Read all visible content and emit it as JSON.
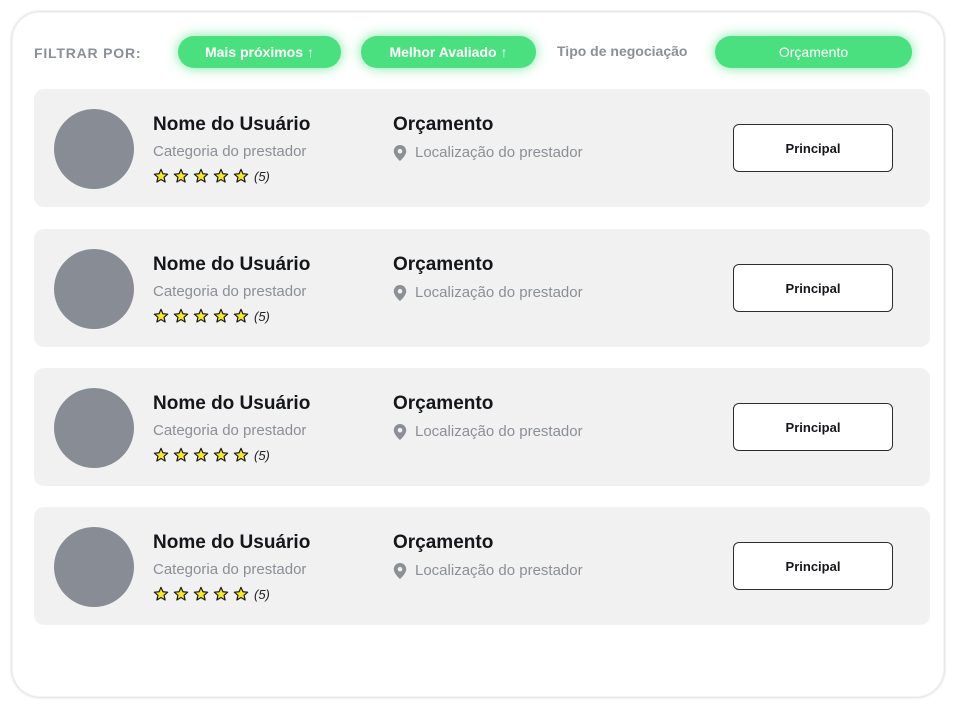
{
  "filters": {
    "label": "FILTRAR POR:",
    "nearest": {
      "label": "Mais próximos",
      "arrow": "↑"
    },
    "best_rated": {
      "label": "Melhor Avaliado",
      "arrow": "↑"
    },
    "negotiation_label": "Tipo de negociação",
    "negotiation_value": "Orçamento"
  },
  "colors": {
    "accent": "#4be07f",
    "card_bg": "#f1f1f1",
    "avatar": "#878c95",
    "star_fill": "#f5e733"
  },
  "cards": [
    {
      "name": "Nome do Usuário",
      "category": "Categoria do prestador",
      "stars": 5,
      "rating_count": "(5)",
      "negotiation": "Orçamento",
      "location": "Localização do prestador",
      "button": "Principal"
    },
    {
      "name": "Nome do Usuário",
      "category": "Categoria do prestador",
      "stars": 5,
      "rating_count": "(5)",
      "negotiation": "Orçamento",
      "location": "Localização do prestador",
      "button": "Principal"
    },
    {
      "name": "Nome do Usuário",
      "category": "Categoria do prestador",
      "stars": 5,
      "rating_count": "(5)",
      "negotiation": "Orçamento",
      "location": "Localização do prestador",
      "button": "Principal"
    },
    {
      "name": "Nome do Usuário",
      "category": "Categoria do prestador",
      "stars": 5,
      "rating_count": "(5)",
      "negotiation": "Orçamento",
      "location": "Localização do prestador",
      "button": "Principal"
    }
  ]
}
